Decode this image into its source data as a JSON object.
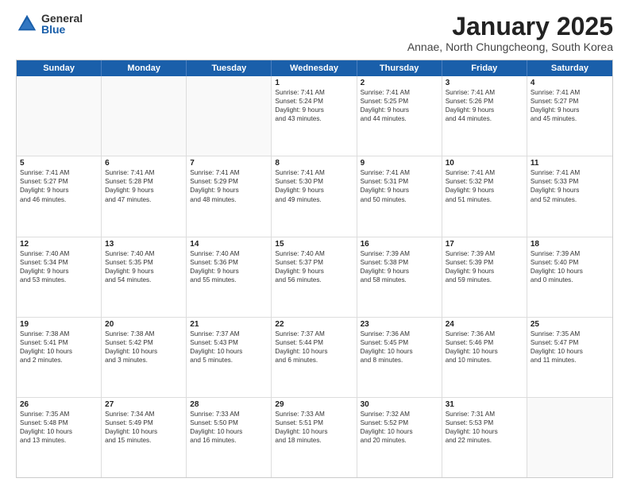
{
  "logo": {
    "general": "General",
    "blue": "Blue"
  },
  "title": "January 2025",
  "location": "Annae, North Chungcheong, South Korea",
  "dayHeaders": [
    "Sunday",
    "Monday",
    "Tuesday",
    "Wednesday",
    "Thursday",
    "Friday",
    "Saturday"
  ],
  "weeks": [
    [
      {
        "day": "",
        "info": ""
      },
      {
        "day": "",
        "info": ""
      },
      {
        "day": "",
        "info": ""
      },
      {
        "day": "1",
        "info": "Sunrise: 7:41 AM\nSunset: 5:24 PM\nDaylight: 9 hours\nand 43 minutes."
      },
      {
        "day": "2",
        "info": "Sunrise: 7:41 AM\nSunset: 5:25 PM\nDaylight: 9 hours\nand 44 minutes."
      },
      {
        "day": "3",
        "info": "Sunrise: 7:41 AM\nSunset: 5:26 PM\nDaylight: 9 hours\nand 44 minutes."
      },
      {
        "day": "4",
        "info": "Sunrise: 7:41 AM\nSunset: 5:27 PM\nDaylight: 9 hours\nand 45 minutes."
      }
    ],
    [
      {
        "day": "5",
        "info": "Sunrise: 7:41 AM\nSunset: 5:27 PM\nDaylight: 9 hours\nand 46 minutes."
      },
      {
        "day": "6",
        "info": "Sunrise: 7:41 AM\nSunset: 5:28 PM\nDaylight: 9 hours\nand 47 minutes."
      },
      {
        "day": "7",
        "info": "Sunrise: 7:41 AM\nSunset: 5:29 PM\nDaylight: 9 hours\nand 48 minutes."
      },
      {
        "day": "8",
        "info": "Sunrise: 7:41 AM\nSunset: 5:30 PM\nDaylight: 9 hours\nand 49 minutes."
      },
      {
        "day": "9",
        "info": "Sunrise: 7:41 AM\nSunset: 5:31 PM\nDaylight: 9 hours\nand 50 minutes."
      },
      {
        "day": "10",
        "info": "Sunrise: 7:41 AM\nSunset: 5:32 PM\nDaylight: 9 hours\nand 51 minutes."
      },
      {
        "day": "11",
        "info": "Sunrise: 7:41 AM\nSunset: 5:33 PM\nDaylight: 9 hours\nand 52 minutes."
      }
    ],
    [
      {
        "day": "12",
        "info": "Sunrise: 7:40 AM\nSunset: 5:34 PM\nDaylight: 9 hours\nand 53 minutes."
      },
      {
        "day": "13",
        "info": "Sunrise: 7:40 AM\nSunset: 5:35 PM\nDaylight: 9 hours\nand 54 minutes."
      },
      {
        "day": "14",
        "info": "Sunrise: 7:40 AM\nSunset: 5:36 PM\nDaylight: 9 hours\nand 55 minutes."
      },
      {
        "day": "15",
        "info": "Sunrise: 7:40 AM\nSunset: 5:37 PM\nDaylight: 9 hours\nand 56 minutes."
      },
      {
        "day": "16",
        "info": "Sunrise: 7:39 AM\nSunset: 5:38 PM\nDaylight: 9 hours\nand 58 minutes."
      },
      {
        "day": "17",
        "info": "Sunrise: 7:39 AM\nSunset: 5:39 PM\nDaylight: 9 hours\nand 59 minutes."
      },
      {
        "day": "18",
        "info": "Sunrise: 7:39 AM\nSunset: 5:40 PM\nDaylight: 10 hours\nand 0 minutes."
      }
    ],
    [
      {
        "day": "19",
        "info": "Sunrise: 7:38 AM\nSunset: 5:41 PM\nDaylight: 10 hours\nand 2 minutes."
      },
      {
        "day": "20",
        "info": "Sunrise: 7:38 AM\nSunset: 5:42 PM\nDaylight: 10 hours\nand 3 minutes."
      },
      {
        "day": "21",
        "info": "Sunrise: 7:37 AM\nSunset: 5:43 PM\nDaylight: 10 hours\nand 5 minutes."
      },
      {
        "day": "22",
        "info": "Sunrise: 7:37 AM\nSunset: 5:44 PM\nDaylight: 10 hours\nand 6 minutes."
      },
      {
        "day": "23",
        "info": "Sunrise: 7:36 AM\nSunset: 5:45 PM\nDaylight: 10 hours\nand 8 minutes."
      },
      {
        "day": "24",
        "info": "Sunrise: 7:36 AM\nSunset: 5:46 PM\nDaylight: 10 hours\nand 10 minutes."
      },
      {
        "day": "25",
        "info": "Sunrise: 7:35 AM\nSunset: 5:47 PM\nDaylight: 10 hours\nand 11 minutes."
      }
    ],
    [
      {
        "day": "26",
        "info": "Sunrise: 7:35 AM\nSunset: 5:48 PM\nDaylight: 10 hours\nand 13 minutes."
      },
      {
        "day": "27",
        "info": "Sunrise: 7:34 AM\nSunset: 5:49 PM\nDaylight: 10 hours\nand 15 minutes."
      },
      {
        "day": "28",
        "info": "Sunrise: 7:33 AM\nSunset: 5:50 PM\nDaylight: 10 hours\nand 16 minutes."
      },
      {
        "day": "29",
        "info": "Sunrise: 7:33 AM\nSunset: 5:51 PM\nDaylight: 10 hours\nand 18 minutes."
      },
      {
        "day": "30",
        "info": "Sunrise: 7:32 AM\nSunset: 5:52 PM\nDaylight: 10 hours\nand 20 minutes."
      },
      {
        "day": "31",
        "info": "Sunrise: 7:31 AM\nSunset: 5:53 PM\nDaylight: 10 hours\nand 22 minutes."
      },
      {
        "day": "",
        "info": ""
      }
    ]
  ]
}
